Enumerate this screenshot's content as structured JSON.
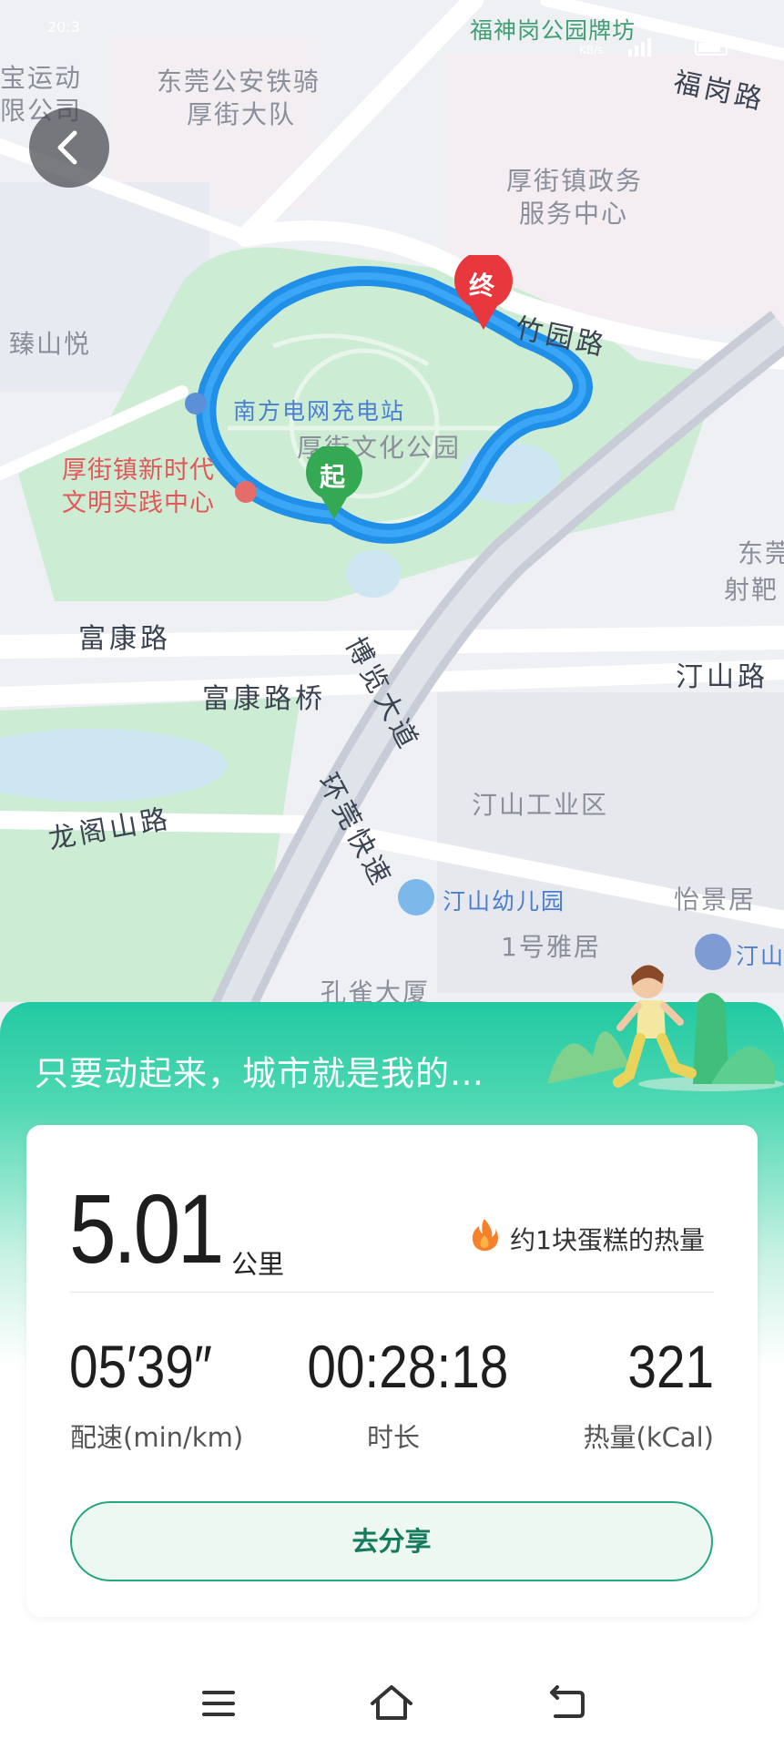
{
  "status_bar": {
    "time": "20:3",
    "net_speed": "KB/s"
  },
  "map": {
    "labels": {
      "fugang_road": "福岗路",
      "zhuyuan_road": "竹园路",
      "fukang_road": "富康路",
      "fukang_bridge": "富康路桥",
      "tingshan_road": "汀山路",
      "longgeshan_road": "龙阁山路",
      "bolan_avenue": "博览大道",
      "huanguan_express": "环莞快速",
      "police_1": "东莞公安铁骑",
      "police_2": "厚街大队",
      "gov_1": "厚街镇政务",
      "gov_2": "服务中心",
      "zhenshanyue": "臻山悦",
      "charging_station": "南方电网充电站",
      "culture_park": "厚街文化公园",
      "civ_center_1": "厚街镇新时代",
      "civ_center_2": "文明实践中心",
      "fushengang": "福神岗公园牌坊",
      "sport_co_1": "宝运动",
      "sport_co_2": "限公司",
      "tingshan_industrial": "汀山工业区",
      "kindergarten": "汀山幼儿园",
      "yaju": "1号雅居",
      "kongque": "孔雀大厦",
      "yijingju": "怡景居",
      "tingshan_right": "汀山",
      "shebachang_1": "东莞",
      "shebachang_2": "射靶",
      "start_marker": "起",
      "end_marker": "终"
    }
  },
  "summary": {
    "slogan": "只要动起来，城市就是我的…",
    "distance_value": "5.01",
    "distance_unit": "公里",
    "calorie_note": "约1块蛋糕的热量",
    "pace_value": "05′39″",
    "pace_label": "配速(min/km)",
    "duration_value": "00:28:18",
    "duration_label": "时长",
    "calories_value": "321",
    "calories_label": "热量(kCal)",
    "share_label": "去分享"
  },
  "colors": {
    "route": "#1f8fe8",
    "accent_green": "#22c9a2",
    "end_marker": "#e8383d",
    "start_marker": "#34a853",
    "share_border": "#24a67f"
  },
  "icons": {
    "back": "chevron-left-icon",
    "flame": "flame-icon",
    "nav_menu": "menu-icon",
    "nav_home": "home-icon",
    "nav_back": "back-icon"
  }
}
